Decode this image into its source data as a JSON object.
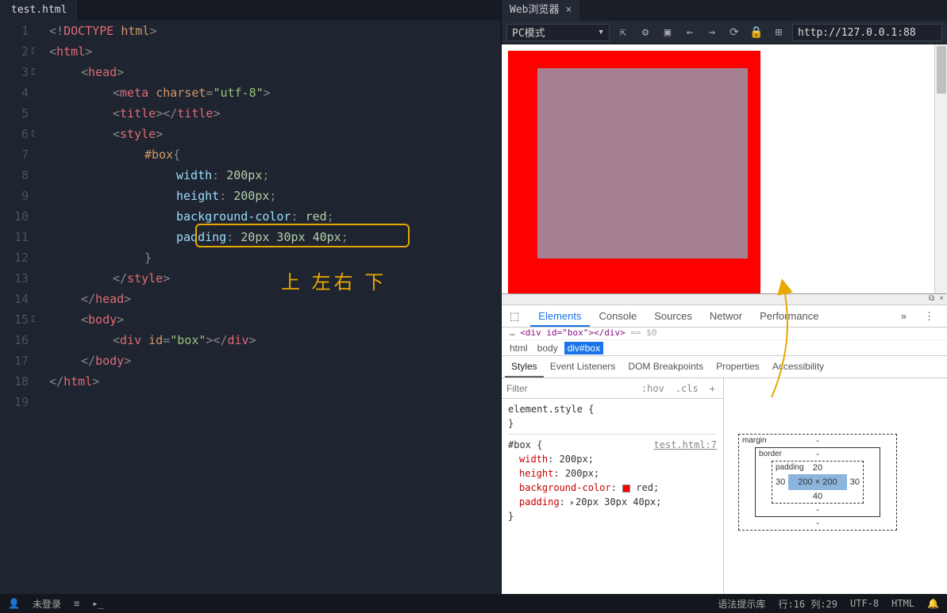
{
  "editor": {
    "tab": "test.html",
    "lines": [
      {
        "n": 1,
        "indent": 0,
        "html": "<span class='p'>&lt;!</span><span class='tag'>DOCTYPE</span> <span class='attr'>html</span><span class='p'>&gt;</span>"
      },
      {
        "n": 2,
        "indent": 0,
        "fold": true,
        "html": "<span class='p'>&lt;</span><span class='tag'>html</span><span class='p'>&gt;</span>"
      },
      {
        "n": 3,
        "indent": 1,
        "fold": true,
        "html": "<span class='p'>&lt;</span><span class='tag'>head</span><span class='p'>&gt;</span>"
      },
      {
        "n": 4,
        "indent": 2,
        "html": "<span class='p'>&lt;</span><span class='tag'>meta</span> <span class='attr'>charset</span><span class='p'>=</span><span class='str'>\"utf-8\"</span><span class='p'>&gt;</span>"
      },
      {
        "n": 5,
        "indent": 2,
        "html": "<span class='p'>&lt;</span><span class='tag'>title</span><span class='p'>&gt;&lt;/</span><span class='tag'>title</span><span class='p'>&gt;</span>"
      },
      {
        "n": 6,
        "indent": 2,
        "fold": true,
        "html": "<span class='p'>&lt;</span><span class='tag'>style</span><span class='p'>&gt;</span>"
      },
      {
        "n": 7,
        "indent": 3,
        "html": "<span class='sel'>#box</span><span class='p'>{</span>"
      },
      {
        "n": 8,
        "indent": 4,
        "html": "<span class='prop'>width</span><span class='p'>:</span> <span class='val'>200px</span><span class='p'>;</span>"
      },
      {
        "n": 9,
        "indent": 4,
        "html": "<span class='prop'>height</span><span class='p'>:</span> <span class='val'>200px</span><span class='p'>;</span>"
      },
      {
        "n": 10,
        "indent": 4,
        "html": "<span class='prop'>background-color</span><span class='p'>:</span> <span class='val'>red</span><span class='p'>;</span>"
      },
      {
        "n": 11,
        "indent": 4,
        "html": "<span class='prop'>padding</span><span class='p'>:</span> <span class='val'>20px 30px 40px</span><span class='p'>;</span>"
      },
      {
        "n": 12,
        "indent": 3,
        "html": "<span class='p'>}</span>"
      },
      {
        "n": 13,
        "indent": 2,
        "html": "<span class='p'>&lt;/</span><span class='tag'>style</span><span class='p'>&gt;</span>"
      },
      {
        "n": 14,
        "indent": 1,
        "html": "<span class='p'>&lt;/</span><span class='tag'>head</span><span class='p'>&gt;</span>"
      },
      {
        "n": 15,
        "indent": 1,
        "fold": true,
        "html": "<span class='p'>&lt;</span><span class='tag'>body</span><span class='p'>&gt;</span>"
      },
      {
        "n": 16,
        "indent": 2,
        "html": "<span class='p'>&lt;</span><span class='tag'>div</span> <span class='attr'>id</span><span class='p'>=</span><span class='str'>\"box\"</span><span class='p'>&gt;&lt;/</span><span class='tag'>div</span><span class='p'>&gt;</span>"
      },
      {
        "n": 17,
        "indent": 1,
        "html": "<span class='p'>&lt;/</span><span class='tag'>body</span><span class='p'>&gt;</span>"
      },
      {
        "n": 18,
        "indent": 0,
        "html": "<span class='p'>&lt;/</span><span class='tag'>html</span><span class='p'>&gt;</span>"
      },
      {
        "n": 19,
        "indent": 0,
        "html": ""
      }
    ],
    "annotation": "上 左右 下"
  },
  "browser": {
    "tab": "Web浏览器",
    "mode": "PC模式",
    "url": "http://127.0.0.1:88"
  },
  "devtools": {
    "tabs": [
      "Elements",
      "Console",
      "Sources",
      "Networ",
      "Performance"
    ],
    "activeTab": "Elements",
    "domLine": "<div id=\"box\"></div> == $0",
    "breadcrumb": [
      "html",
      "body",
      "div#box"
    ],
    "subTabs": [
      "Styles",
      "Event Listeners",
      "DOM Breakpoints",
      "Properties",
      "Accessibility"
    ],
    "activeSubTab": "Styles",
    "filterPlaceholder": "Filter",
    "hov": ":hov",
    "cls": ".cls",
    "elementStyle": "element.style {",
    "ruleSelector": "#box {",
    "ruleSource": "test.html:7",
    "ruleProps": [
      {
        "p": "width",
        "v": "200px;"
      },
      {
        "p": "height",
        "v": "200px;"
      },
      {
        "p": "background-color",
        "v": "red;",
        "swatch": true
      },
      {
        "p": "padding",
        "v": "20px 30px 40px;",
        "tri": true
      }
    ],
    "boxModel": {
      "margin": {
        "label": "margin",
        "t": "-",
        "r": "-",
        "b": "-",
        "l": "-"
      },
      "border": {
        "label": "border",
        "t": "-",
        "r": "-",
        "b": "-",
        "l": "-"
      },
      "padding": {
        "label": "padding",
        "t": "20",
        "r": "30",
        "b": "40",
        "l": "30"
      },
      "content": "200 × 200"
    }
  },
  "statusbar": {
    "login": "未登录",
    "hint": "语法提示库",
    "pos": "行:16 列:29",
    "enc": "UTF-8",
    "lang": "HTML"
  }
}
